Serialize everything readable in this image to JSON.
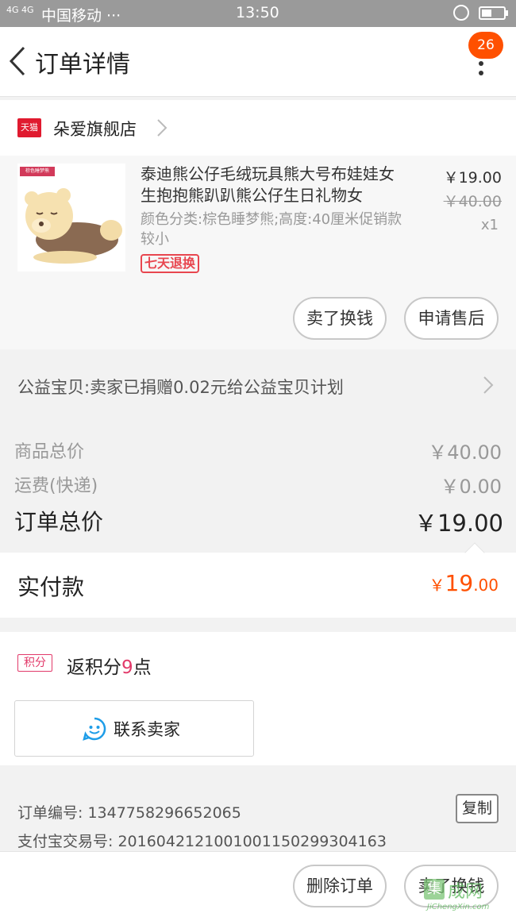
{
  "status_bar": {
    "signal": "4G 4G",
    "carrier": "中国移动 ···",
    "time": "13:50"
  },
  "nav": {
    "title": "订单详情",
    "badge_count": "26"
  },
  "store": {
    "logo_text": "天猫",
    "name": "朵爱旗舰店"
  },
  "product": {
    "image_tag": "棕色睡梦熊",
    "title": "泰迪熊公仔毛绒玩具熊大号布娃娃女生抱抱熊趴趴熊公仔生日礼物女",
    "sku": "颜色分类:棕色睡梦熊;高度:40厘米促销款较小",
    "return_tag": "七天退换",
    "price": "￥19.00",
    "original_price": "￥40.00",
    "quantity": "x1",
    "actions": {
      "sell": "卖了换钱",
      "after_sale": "申请售后"
    }
  },
  "charity": {
    "text": "公益宝贝:卖家已捐赠0.02元给公益宝贝计划"
  },
  "summary": {
    "items_label": "商品总价",
    "items_value": "￥40.00",
    "shipping_label": "运费(快递)",
    "shipping_value": "￥0.00",
    "total_label": "订单总价",
    "total_value": "￥19.00"
  },
  "paid": {
    "label": "实付款",
    "currency": "￥",
    "integer": "19",
    "decimal": ".00"
  },
  "points": {
    "icon_text": "积分",
    "prefix": "返积分",
    "count": "9",
    "suffix": "点"
  },
  "contact": {
    "label": "联系卖家"
  },
  "order_info": {
    "order_no": "订单编号: 1347758296652065",
    "alipay_no": "支付宝交易号: 2016042121001001150299304163",
    "copy_label": "复制"
  },
  "bottom_actions": {
    "delete": "删除订单",
    "sell": "卖了换钱"
  },
  "watermark": {
    "icon": "集",
    "text": "成网",
    "sub": "JiChengXin.com"
  },
  "colors": {
    "accent": "#ff5000",
    "tmall_red": "#e01a2f",
    "points_pink": "#e23a6a"
  }
}
